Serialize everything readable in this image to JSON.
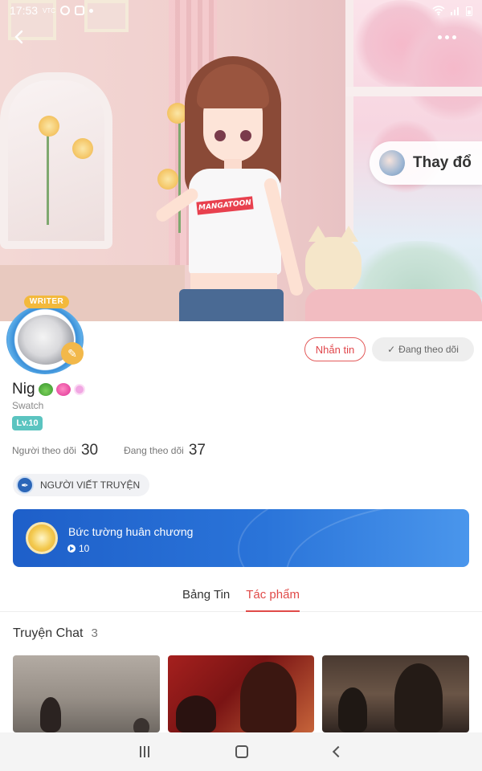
{
  "status_bar": {
    "time": "17:53",
    "left_mini": "VTC"
  },
  "hero": {
    "change_outfit_label": "Thay đổ",
    "shirt_text": "MANGATOON"
  },
  "profile": {
    "writer_tag": "WRITER",
    "username": "Nig",
    "subname": "Swatch",
    "level": "Lv.10",
    "message_button": "Nhắn tin",
    "following_button": "Đang theo dõi",
    "following_check": "✓"
  },
  "stats": {
    "followers_label": "Người theo dõi",
    "followers_value": "30",
    "following_label": "Đang theo dõi",
    "following_value": "37"
  },
  "role": {
    "label": "NGƯỜI VIẾT TRUYỆN"
  },
  "medal": {
    "title": "Bức tường huân chương",
    "count": "10"
  },
  "tabs": [
    {
      "label": "Bảng Tin",
      "active": false
    },
    {
      "label": "Tác phẩm",
      "active": true
    }
  ],
  "section": {
    "title": "Truyện Chat",
    "count": "3"
  },
  "colors": {
    "accent_red": "#e04a48",
    "medal_blue": "#2a74d9",
    "level_teal": "#5bc4c0"
  },
  "icons": {
    "back": "arrow-left-icon",
    "more": "more-dots-icon",
    "check": "check-icon",
    "role": "pen-nib-icon",
    "medal": "medal-icon",
    "nav": [
      "recents-icon",
      "home-icon",
      "back-icon"
    ]
  }
}
